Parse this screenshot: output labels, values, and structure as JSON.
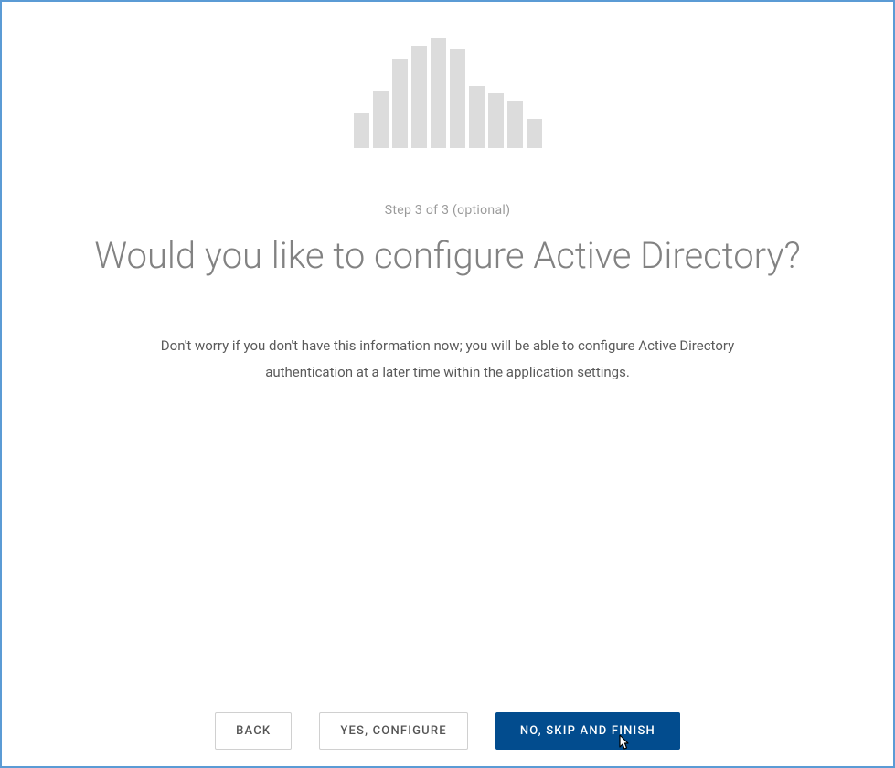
{
  "logo": {
    "bars": [
      38,
      62,
      98,
      112,
      120,
      108,
      68,
      60,
      52,
      32
    ]
  },
  "step_label": "Step 3 of 3 (optional)",
  "heading": "Would you like to configure Active Directory?",
  "description": "Don't worry if you don't have this information now; you will be able to configure Active Directory authentication at a later time within the application settings.",
  "buttons": {
    "back": "Back",
    "yes": "Yes, Configure",
    "no": "No, Skip and Finish"
  },
  "colors": {
    "border": "#5b9bd5",
    "primary_button_bg": "#024c8e",
    "bar_fill": "#dcdcdc",
    "heading_text": "#828282"
  }
}
